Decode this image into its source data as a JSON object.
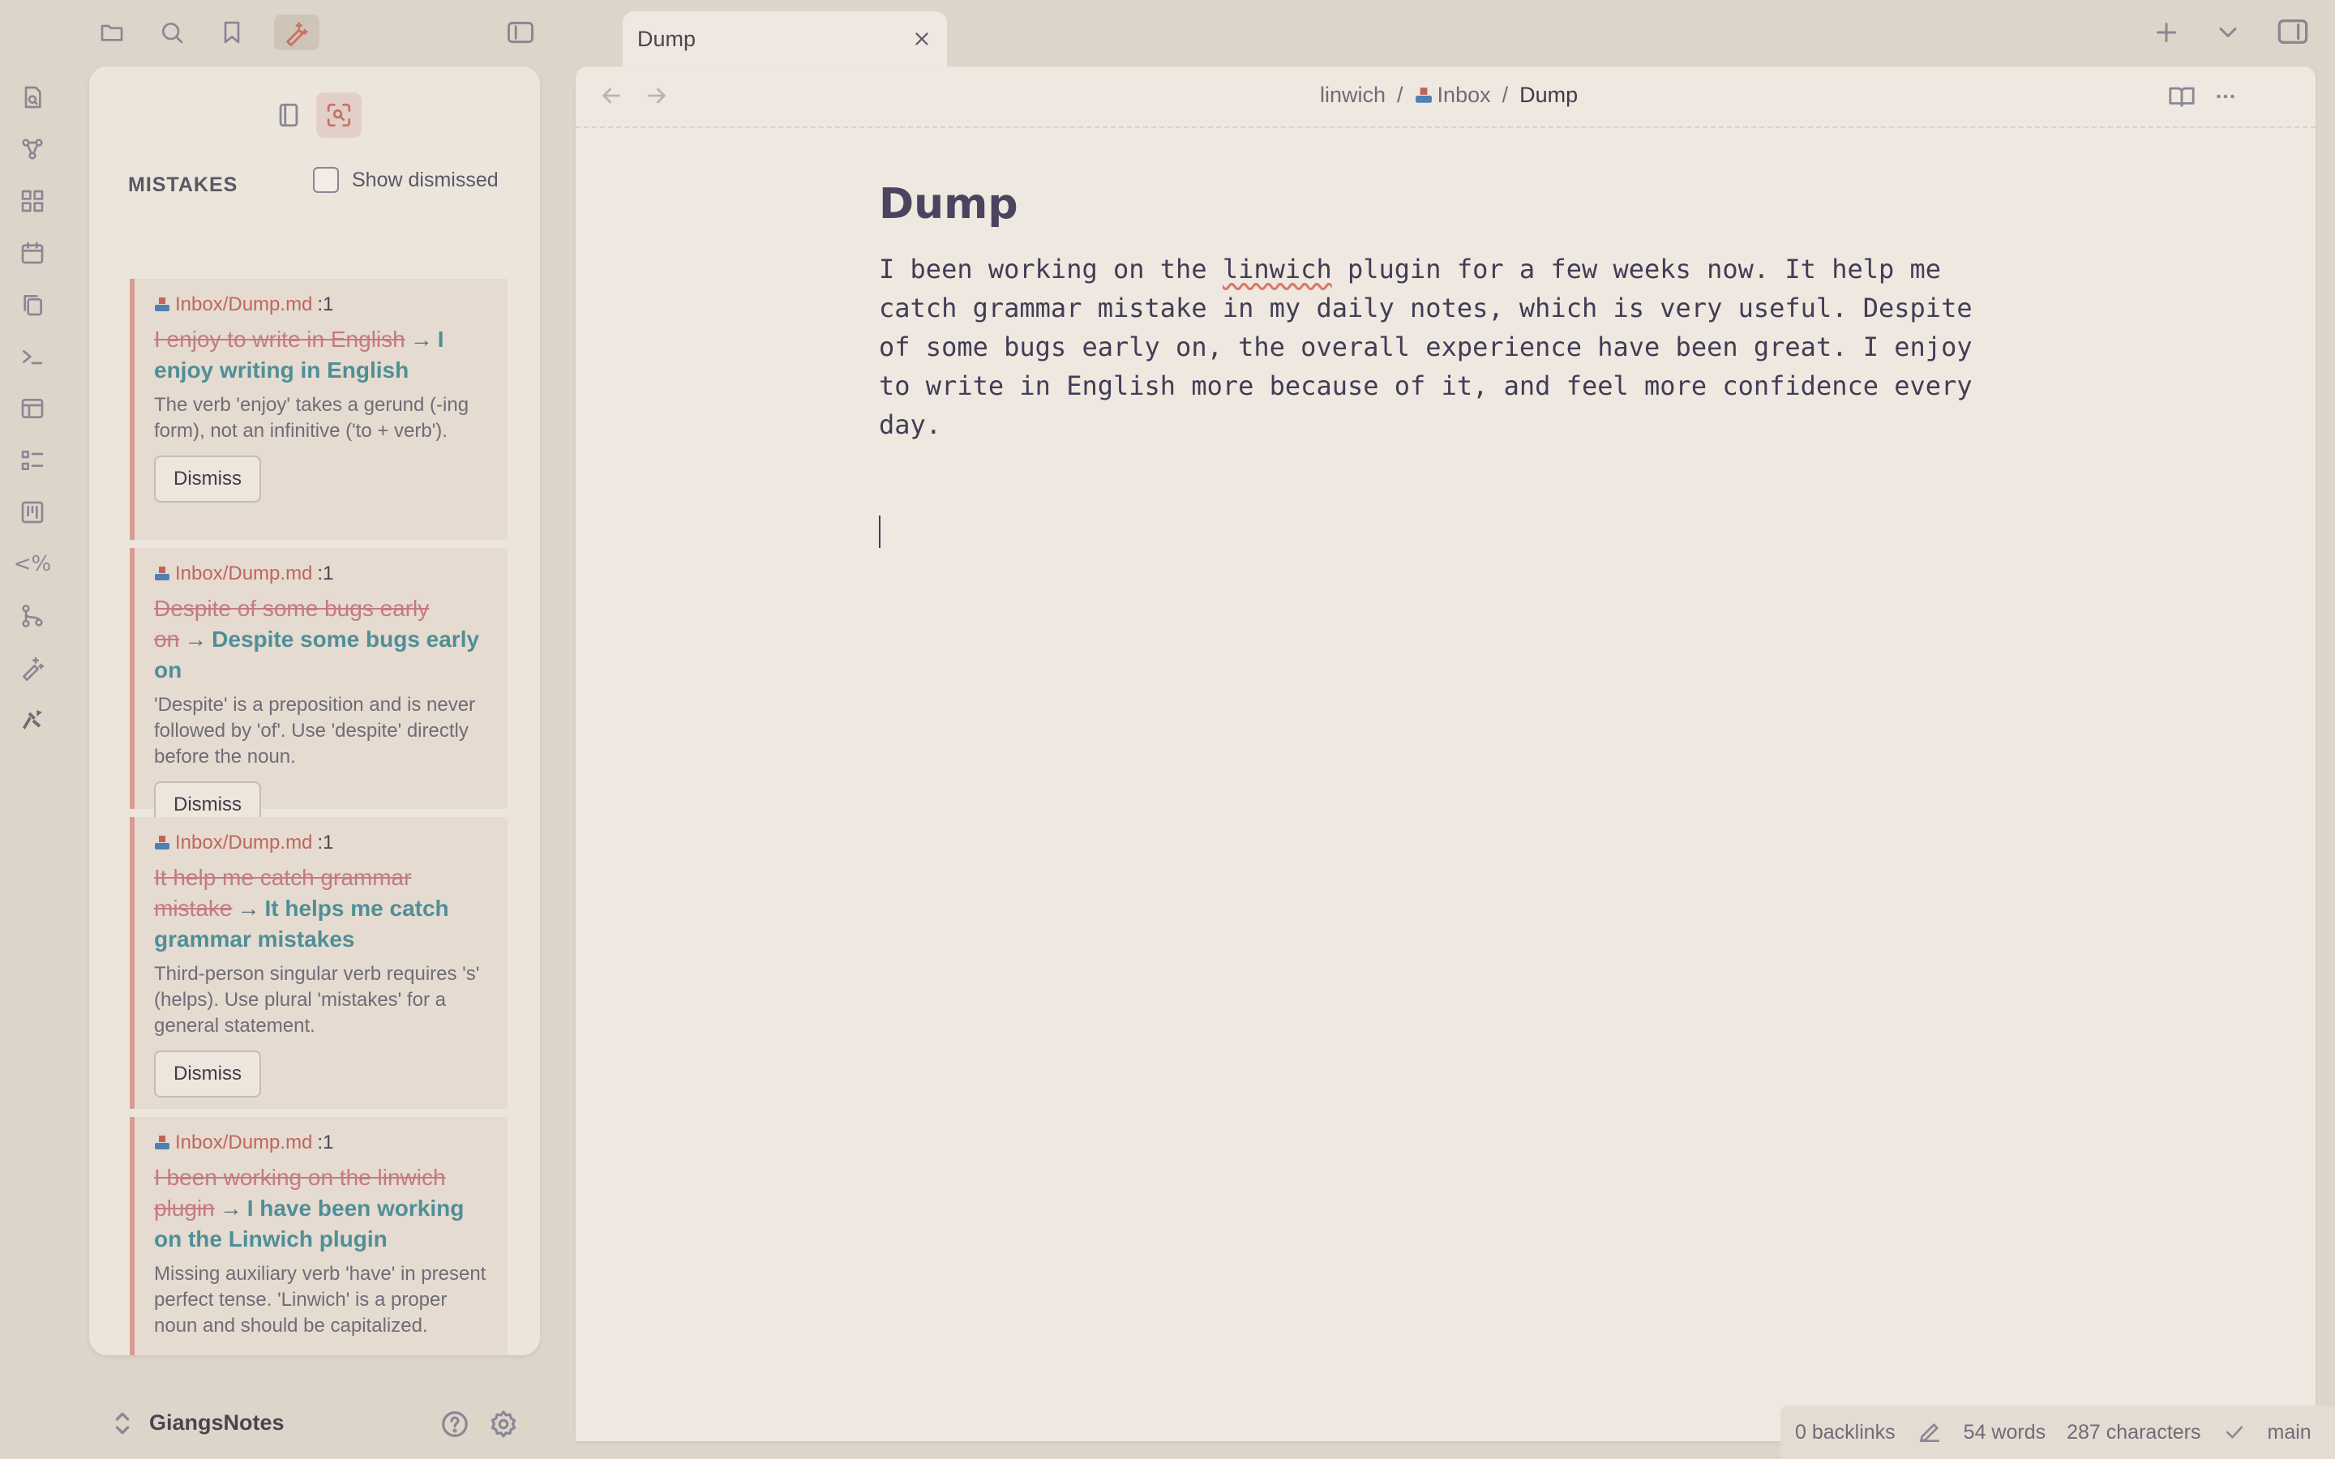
{
  "ribbon": {
    "items": [
      "file-search-icon",
      "graph-icon",
      "canvas-icon",
      "calendar-icon",
      "copy-icon",
      "terminal-icon",
      "table-icon",
      "list-icon",
      "kanban-icon",
      "template-icon",
      "git-icon",
      "sparkles-pen-icon",
      "linwich-icon"
    ],
    "template_label": "<%"
  },
  "toolbar": {
    "buttons": [
      "folder-icon",
      "search-icon",
      "bookmark-icon",
      "linwich-pen-icon"
    ],
    "sidebar_toggle": "sidebar-toggle-icon"
  },
  "sidebar": {
    "title": "MISTAKES",
    "show_dismissed_label": "Show dismissed",
    "show_dismissed_checked": false,
    "cards": [
      {
        "source": "Inbox/Dump.md",
        "line": ":1",
        "original": "I enjoy to write in English",
        "arrow": "→",
        "correction": "I enjoy writing in English",
        "explanation": "The verb 'enjoy' takes a gerund (-ing form), not an infinitive ('to + verb').",
        "button": "Dismiss"
      },
      {
        "source": "Inbox/Dump.md",
        "line": ":1",
        "original": "Despite of some bugs early on",
        "arrow": "→",
        "correction": "Despite some bugs early on",
        "explanation": "'Despite' is a preposition and is never followed by 'of'. Use 'despite' directly before the noun.",
        "button": "Dismiss"
      },
      {
        "source": "Inbox/Dump.md",
        "line": ":1",
        "original": "It help me catch grammar mistake",
        "arrow": "→",
        "correction": "It helps me catch grammar mistakes",
        "explanation": "Third-person singular verb requires 's' (helps). Use plural 'mistakes' for a general statement.",
        "button": "Dismiss"
      },
      {
        "source": "Inbox/Dump.md",
        "line": ":1",
        "original": "I been working on the linwich plugin",
        "arrow": "→",
        "correction": "I have been working on the Linwich plugin",
        "explanation": "Missing auxiliary verb 'have' in present perfect tense. 'Linwich' is a proper noun and should be capitalized."
      }
    ]
  },
  "vault": {
    "name": "GiangsNotes"
  },
  "tab": {
    "title": "Dump"
  },
  "breadcrumb": {
    "root": "linwich",
    "sep": "/",
    "folder": "Inbox",
    "current": "Dump"
  },
  "note": {
    "title": "Dump",
    "body_before": "I been working on the ",
    "body_flagged": "linwich",
    "body_after": " plugin for a few weeks now. It help me catch grammar mistake in my daily notes, which is very useful. Despite of some bugs early on, the overall experience have been great. I enjoy to write in English more because of it, and feel more confidence every day."
  },
  "status": {
    "backlinks": "0 backlinks",
    "words": "54 words",
    "characters": "287 characters",
    "branch": "main"
  }
}
